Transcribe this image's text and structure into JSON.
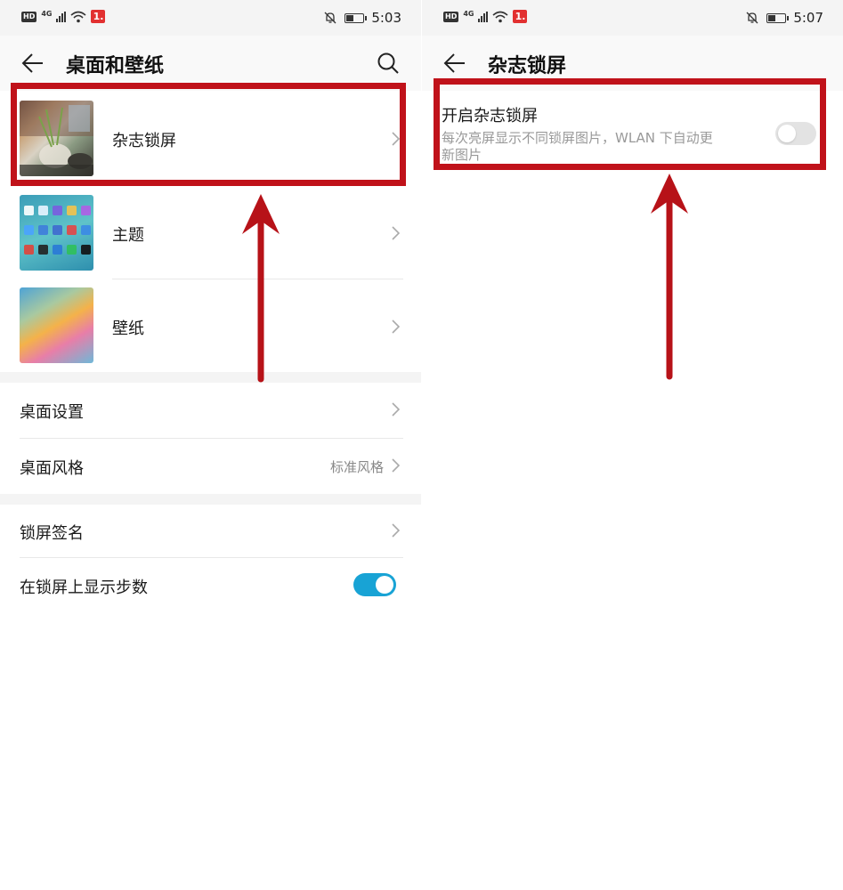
{
  "left": {
    "status": {
      "hd": "HD",
      "net": "4G",
      "badge": "1.",
      "time": "5:03"
    },
    "header": {
      "title": "桌面和壁纸"
    },
    "items": [
      {
        "label": "杂志锁屏"
      },
      {
        "label": "主题"
      },
      {
        "label": "壁纸"
      }
    ],
    "settings": [
      {
        "label": "桌面设置"
      },
      {
        "label": "桌面风格",
        "value": "标准风格"
      }
    ],
    "lock": [
      {
        "label": "锁屏签名"
      },
      {
        "label": "在锁屏上显示步数",
        "toggle": true
      }
    ]
  },
  "right": {
    "status": {
      "hd": "HD",
      "net": "4G",
      "badge": "1.",
      "time": "5:07"
    },
    "header": {
      "title": "杂志锁屏"
    },
    "option": {
      "label": "开启杂志锁屏",
      "desc_line1": "每次亮屏显示不同锁屏图片，WLAN 下自动更",
      "desc_line2": "新图片",
      "toggle": false
    }
  },
  "colors": {
    "accent": "#18a3d5",
    "highlight": "#c0121a"
  },
  "icons": [
    "back-arrow-icon",
    "search-icon",
    "chevron-right-icon",
    "mute-bell-icon",
    "battery-icon",
    "wifi-icon",
    "signal-icon"
  ]
}
